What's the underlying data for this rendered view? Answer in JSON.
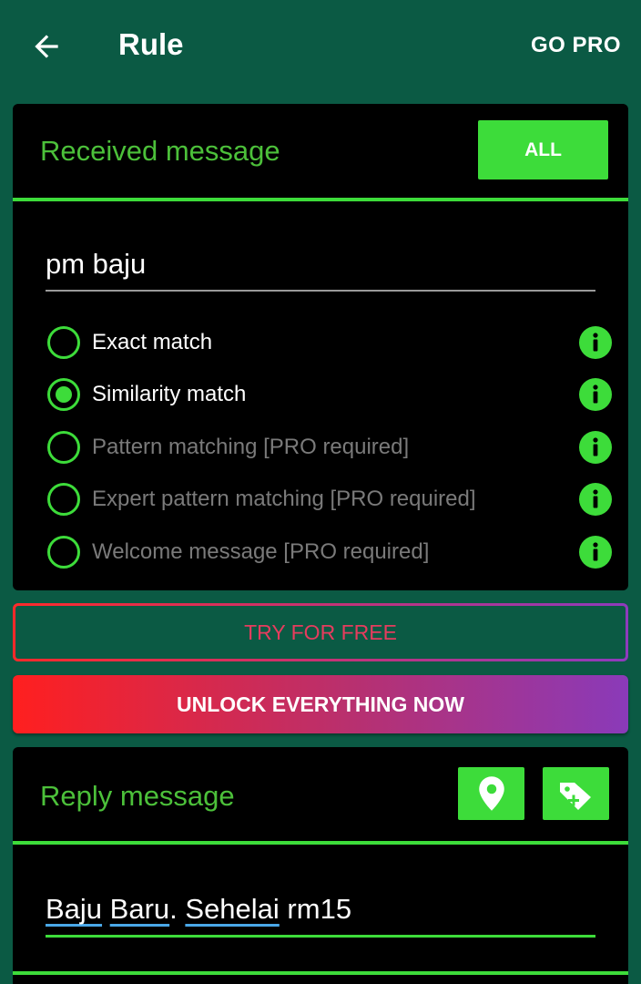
{
  "appbar": {
    "title": "Rule",
    "go_pro_label": "GO PRO"
  },
  "received": {
    "header": "Received message",
    "all_label": "ALL",
    "input_value": "pm baju",
    "options": [
      {
        "label": "Exact match",
        "selected": false,
        "disabled": false
      },
      {
        "label": "Similarity match",
        "selected": true,
        "disabled": false
      },
      {
        "label": "Pattern matching [PRO required]",
        "selected": false,
        "disabled": true
      },
      {
        "label": "Expert pattern matching [PRO required]",
        "selected": false,
        "disabled": true
      },
      {
        "label": "Welcome message [PRO required]",
        "selected": false,
        "disabled": true
      }
    ]
  },
  "try_label": "TRY FOR FREE",
  "unlock_label": "UNLOCK EVERYTHING NOW",
  "reply": {
    "header": "Reply message",
    "words": [
      "Baju",
      " ",
      "Baru",
      ". ",
      "Sehelai",
      " rm15"
    ]
  },
  "colors": {
    "background": "#0b5a44",
    "accent_green": "#3ddc3a",
    "header_green": "#4cc03a",
    "gradient_start": "#ff1f1f",
    "gradient_end": "#8a3ab9"
  }
}
